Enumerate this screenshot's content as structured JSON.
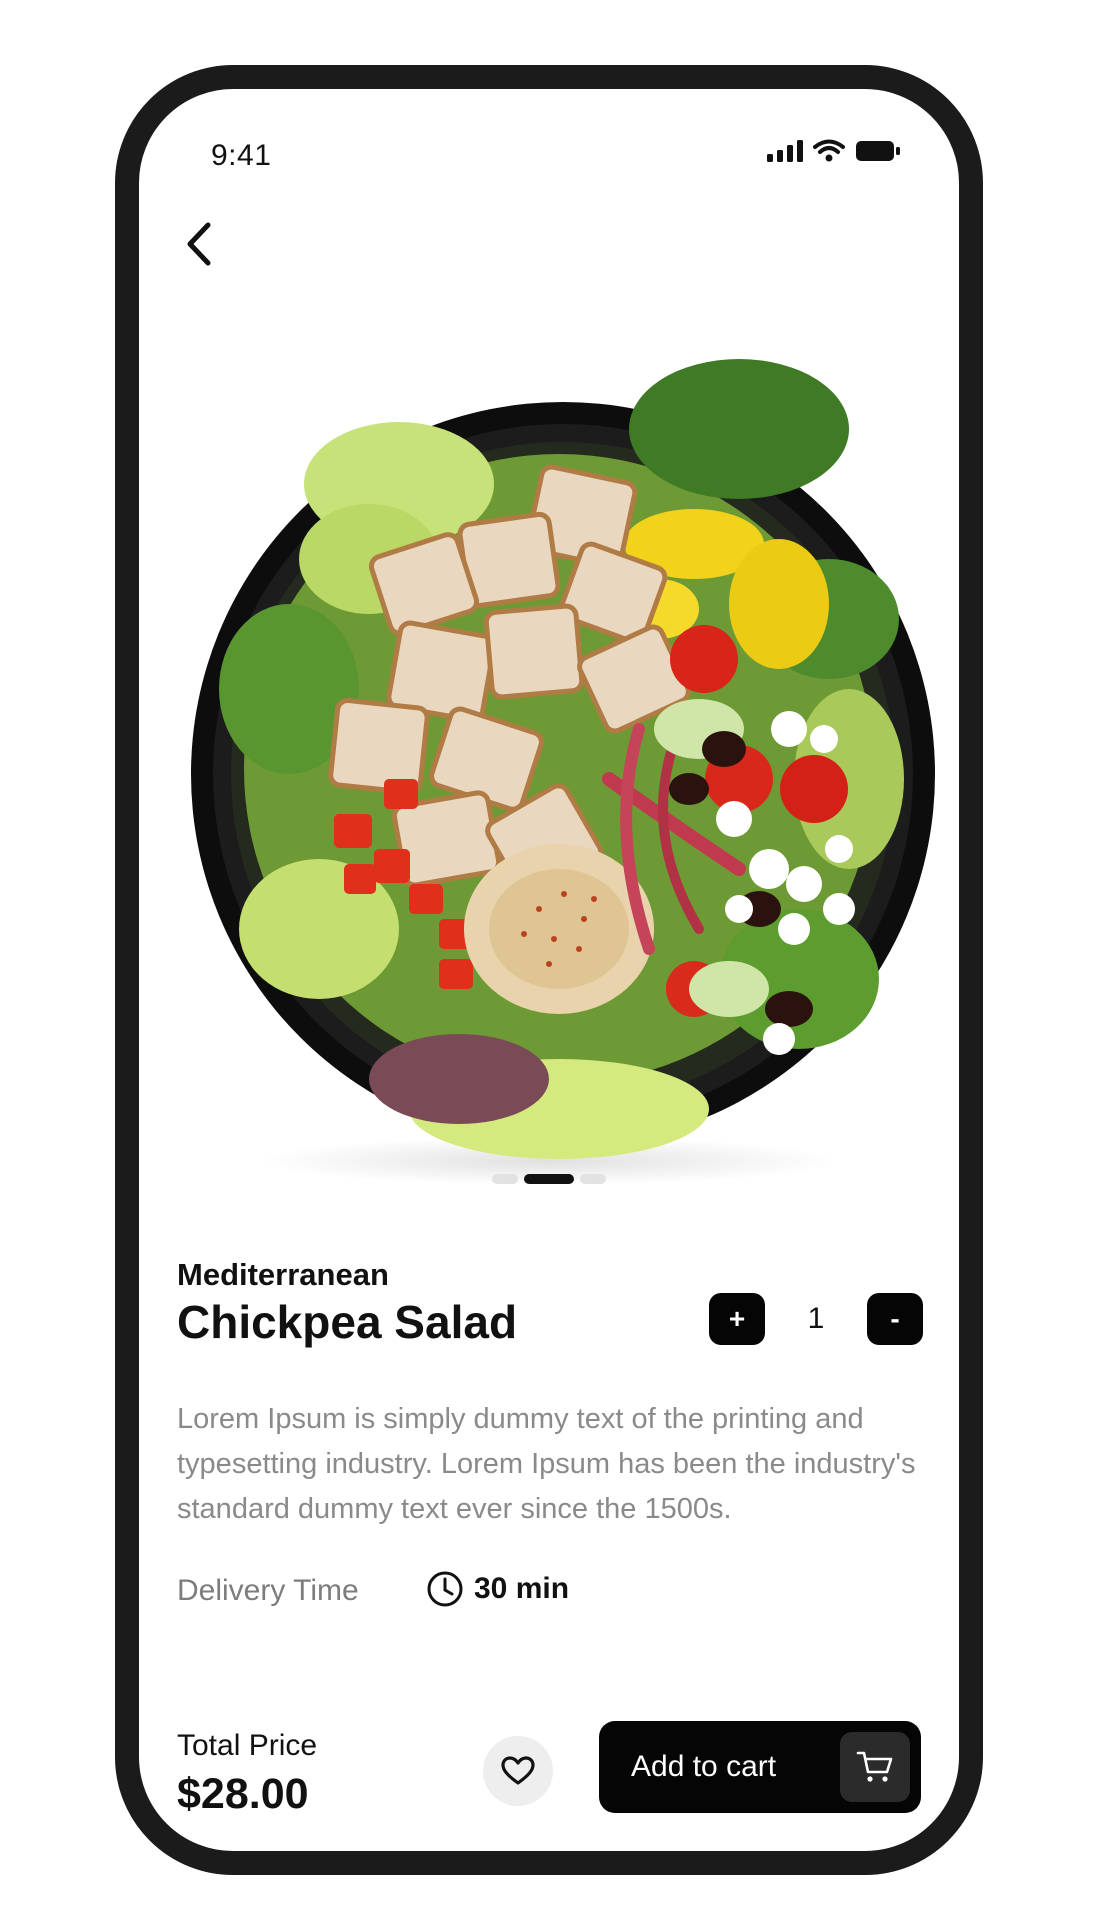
{
  "status_bar": {
    "time": "9:41"
  },
  "icons": {
    "back": "chevron-left-icon",
    "signal": "signal-bars-icon",
    "wifi": "wifi-icon",
    "battery": "battery-icon",
    "clock": "clock-icon",
    "heart": "heart-icon",
    "cart": "cart-icon"
  },
  "carousel": {
    "total_slides": 3,
    "active_slide": 2
  },
  "product": {
    "subtitle": "Mediterranean",
    "title": "Chickpea Salad",
    "description": "Lorem Ipsum is simply dummy text of the printing and typesetting industry. Lorem Ipsum has been the industry's standard dummy text ever since the 1500s.",
    "quantity": {
      "increment_label": "+",
      "value": "1",
      "decrement_label": "-"
    }
  },
  "delivery": {
    "label": "Delivery Time",
    "value": "30 min"
  },
  "checkout": {
    "total_label": "Total Price",
    "total_value": "$28.00",
    "add_to_cart_label": "Add to cart"
  },
  "colors": {
    "primary": "#050505",
    "text_muted": "#8a8a8a",
    "frame": "#1b1b1b"
  }
}
